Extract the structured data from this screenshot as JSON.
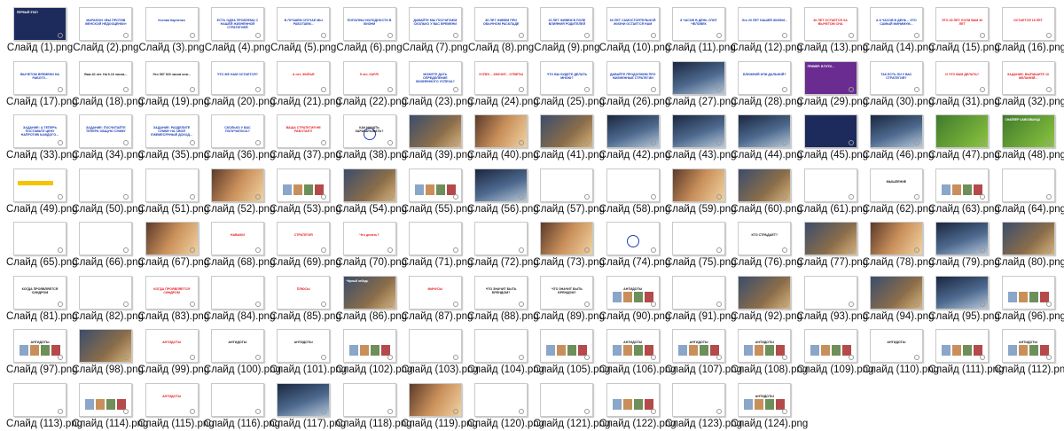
{
  "file_label_prefix": "Слайд",
  "file_label_suffix": ".png",
  "slides": [
    {
      "label": "Слайд (1).png",
      "kind": "navy",
      "text": "ПЕРВЫЙ ЭТАП"
    },
    {
      "label": "Слайд (2).png",
      "kind": "white-blue",
      "text": "МАРАФОН «ВЫ ПРОТИВ ЖЕНСКОЙ НЕДООЦЕНКИ»"
    },
    {
      "label": "Слайд (3).png",
      "kind": "white-blue",
      "text": "Ксения Карпенко"
    },
    {
      "label": "Слайд (4).png",
      "kind": "white-blue",
      "text": "ЕСТЬ ОДНА ПРОБЛЕМА С НАШЕЙ ЖИЗНЕННОЙ СТРАТЕГИЕЙ"
    },
    {
      "label": "Слайд (5).png",
      "kind": "white-blue",
      "text": "В ЛУЧШЕМ СЛУЧАЕ МЫ РАБОТАЕМ..."
    },
    {
      "label": "Слайд (6).png",
      "kind": "white-blue",
      "text": "ПОПОЛНЫ НОЛОДНОСТИ В ЖИЗНИ"
    },
    {
      "label": "Слайд (7).png",
      "kind": "white-blue",
      "text": "ДАВАЙТЕ МЫ ПОСЧИТАЕМ СКОЛЬКО У ВАС ВРЕМЕНИ"
    },
    {
      "label": "Слайд (8).png",
      "kind": "white-blue",
      "text": "80 ЛЕТ ЖИВЕМ ПРИ ОБЫЧНОМ РАСКЛАДЕ"
    },
    {
      "label": "Слайд (9).png",
      "kind": "white-blue",
      "text": "20 ЛЕТ ЖИВЕМ В ПОЛЕ ВЛИЯНИЯ РОДИТЕЛЕЙ"
    },
    {
      "label": "Слайд (10).png",
      "kind": "white-blue",
      "text": "60 ЛЕТ САМОСТОЯТЕЛЬНОЙ ЖИЗНИ ОСТАЕТСЯ НАМ"
    },
    {
      "label": "Слайд (11).png",
      "kind": "white-blue",
      "text": "8 ЧАСОВ В ДЕНЬ СПИТ ЧЕЛОВЕК"
    },
    {
      "label": "Слайд (12).png",
      "kind": "white-blue",
      "text": "Это 20 ЛЕТ НАШЕЙ ЖИЗНИ..."
    },
    {
      "label": "Слайд (13).png",
      "kind": "white-red",
      "text": "40 ЛЕТ ОСТАЕТСЯ ЗА ВЫЧЕТОМ СНА"
    },
    {
      "label": "Слайд (14).png",
      "kind": "white-blue",
      "text": "А 8 ЧАСОВ В ДЕНЬ – ЭТО САМЫЙ МИНИМУМ..."
    },
    {
      "label": "Слайд (15).png",
      "kind": "white-red",
      "text": "ЭТО 25 ЛЕТ. ЕСЛИ ВАМ 40 ЛЕТ"
    },
    {
      "label": "Слайд (16).png",
      "kind": "white-red",
      "text": "ОСТАЕТСЯ 15 ЛЕТ"
    },
    {
      "label": "Слайд (17).png",
      "kind": "white-blue",
      "text": "ВЫЧЕТОМ ВРЕМЕНИ НА РАБОТУ..."
    },
    {
      "label": "Слайд (18).png",
      "kind": "white-black",
      "text": "Вам 40 лет. На 9-10 часов..."
    },
    {
      "label": "Слайд (19).png",
      "kind": "white-black",
      "text": "Это 587 520 часов или..."
    },
    {
      "label": "Слайд (20).png",
      "kind": "white-blue",
      "text": "ЧТО ЖЕ НАМ ОСТАЕТСЯ?"
    },
    {
      "label": "Слайд (21).png",
      "kind": "white-red",
      "text": "А нет, ЖИЛЬЯ"
    },
    {
      "label": "Слайд (22).png",
      "kind": "white-red",
      "text": "5 лет, КАРЛ!"
    },
    {
      "label": "Слайд (23).png",
      "kind": "white-blue",
      "text": "МОЖЕТЕ ДАТЬ ОПРЕДЕЛЕНИЕ ЖИЗНЕННОГО УСПЕХА?"
    },
    {
      "label": "Слайд (24).png",
      "kind": "white-red",
      "text": "УСПЕХ – ЗНАЧИТ... ОТВЕТЫ"
    },
    {
      "label": "Слайд (25).png",
      "kind": "white-blue",
      "text": "ЧТО ВЫ БУДЕТЕ ДЕЛАТЬ МНОЮ?"
    },
    {
      "label": "Слайд (26).png",
      "kind": "white-blue",
      "text": "ДАВАЙТЕ ПРОДОЛЖИМ ПРО ЖИЗНЕННЫЕ СТРАТЕГИИ"
    },
    {
      "label": "Слайд (27).png",
      "kind": "photo2",
      "text": ""
    },
    {
      "label": "Слайд (28).png",
      "kind": "white-blue",
      "text": "БЛИЖНИЙ ИЛИ ДАЛЬНИЙ?"
    },
    {
      "label": "Слайд (29).png",
      "kind": "purple",
      "text": "ПРИМЕР: В ПУТИ..."
    },
    {
      "label": "Слайд (30).png",
      "kind": "white-blue",
      "text": "ТАК ЕСТЬ ЛИ У ВАС СТРАТЕГИЯ?"
    },
    {
      "label": "Слайд (31).png",
      "kind": "white-red",
      "text": "И ЧТО ВАМ ДЕЛАТЬ?"
    },
    {
      "label": "Слайд (32).png",
      "kind": "white-red",
      "text": "ЗАДАНИЕ: ВЫПИШИТЕ 10 ЖЕЛАНИЙ..."
    },
    {
      "label": "Слайд (33).png",
      "kind": "white-blue",
      "text": "ЗАДАНИЕ: А ТЕПЕРЬ ПОСТАВЬТЕ ЦЕНУ НАПРОТИВ КАЖДОГО..."
    },
    {
      "label": "Слайд (34).png",
      "kind": "white-blue",
      "text": "ЗАДАНИЕ: ПОСЧИТАЙТЕ ТЕПЕРЬ ОБЩУЮ СУММУ"
    },
    {
      "label": "Слайд (35).png",
      "kind": "white-blue",
      "text": "ЗАДАНИЕ: РАЗДЕЛИТЕ СУММУ НА СВОЙ ЕЖЕМЕСЯЧНЫЙ ДОХОД..."
    },
    {
      "label": "Слайд (36).png",
      "kind": "white-blue",
      "text": "СКОЛЬКО У ВАС ПОЛУЧИЛОСЬ?"
    },
    {
      "label": "Слайд (37).png",
      "kind": "white-red",
      "text": "ВАША СТРАТЕГИЯ НЕ РАБОТАЕТ!"
    },
    {
      "label": "Слайд (38).png",
      "kind": "white-diagram",
      "text": "КАК НАЧАТЬ ЗАРАБАТЫВАТЬ?"
    },
    {
      "label": "Слайд (39).png",
      "kind": "photo1",
      "text": ""
    },
    {
      "label": "Слайд (40).png",
      "kind": "photo3",
      "text": ""
    },
    {
      "label": "Слайд (41).png",
      "kind": "photo1",
      "text": ""
    },
    {
      "label": "Слайд (42).png",
      "kind": "photo2",
      "text": ""
    },
    {
      "label": "Слайд (43).png",
      "kind": "photo2",
      "text": ""
    },
    {
      "label": "Слайд (44).png",
      "kind": "photo2",
      "text": ""
    },
    {
      "label": "Слайд (45).png",
      "kind": "navy",
      "text": ""
    },
    {
      "label": "Слайд (46).png",
      "kind": "photo2",
      "text": ""
    },
    {
      "label": "Слайд (47).png",
      "kind": "green",
      "text": ""
    },
    {
      "label": "Слайд (48).png",
      "kind": "green",
      "text": "СНАЙПЕР САМОЗВАНЦА"
    },
    {
      "label": "Слайд (49).png",
      "kind": "white-yellow",
      "text": ""
    },
    {
      "label": "Слайд (50).png",
      "kind": "white-black",
      "text": ""
    },
    {
      "label": "Слайд (51).png",
      "kind": "white-black",
      "text": ""
    },
    {
      "label": "Слайд (52).png",
      "kind": "photo3",
      "text": ""
    },
    {
      "label": "Слайд (53).png",
      "kind": "white-collage",
      "text": ""
    },
    {
      "label": "Слайд (54).png",
      "kind": "photo1",
      "text": ""
    },
    {
      "label": "Слайд (55).png",
      "kind": "white-collage",
      "text": ""
    },
    {
      "label": "Слайд (56).png",
      "kind": "photo2",
      "text": ""
    },
    {
      "label": "Слайд (57).png",
      "kind": "white-black",
      "text": ""
    },
    {
      "label": "Слайд (58).png",
      "kind": "white-black",
      "text": ""
    },
    {
      "label": "Слайд (59).png",
      "kind": "photo3",
      "text": ""
    },
    {
      "label": "Слайд (60).png",
      "kind": "photo1",
      "text": ""
    },
    {
      "label": "Слайд (61).png",
      "kind": "white-black",
      "text": ""
    },
    {
      "label": "Слайд (62).png",
      "kind": "white-black",
      "text": "МЫШЛЕНИЕ"
    },
    {
      "label": "Слайд (63).png",
      "kind": "white-collage",
      "text": ""
    },
    {
      "label": "Слайд (64).png",
      "kind": "white-black",
      "text": ""
    },
    {
      "label": "Слайд (65).png",
      "kind": "white-black",
      "text": ""
    },
    {
      "label": "Слайд (66).png",
      "kind": "white-black",
      "text": ""
    },
    {
      "label": "Слайд (67).png",
      "kind": "photo3",
      "text": ""
    },
    {
      "label": "Слайд (68).png",
      "kind": "white-red",
      "text": "НАВЫКИ"
    },
    {
      "label": "Слайд (69).png",
      "kind": "white-red",
      "text": "СТРАТЕГИЯ"
    },
    {
      "label": "Слайд (70).png",
      "kind": "white-red",
      "text": "Что делать?"
    },
    {
      "label": "Слайд (71).png",
      "kind": "white-black",
      "text": ""
    },
    {
      "label": "Слайд (72).png",
      "kind": "white-black",
      "text": ""
    },
    {
      "label": "Слайд (73).png",
      "kind": "photo3",
      "text": ""
    },
    {
      "label": "Слайд (74).png",
      "kind": "white-diagram",
      "text": ""
    },
    {
      "label": "Слайд (75).png",
      "kind": "white-red",
      "text": ""
    },
    {
      "label": "Слайд (76).png",
      "kind": "white-black",
      "text": "КТО СТРАДАЕТ?"
    },
    {
      "label": "Слайд (77).png",
      "kind": "photo1",
      "text": ""
    },
    {
      "label": "Слайд (78).png",
      "kind": "photo3",
      "text": ""
    },
    {
      "label": "Слайд (79).png",
      "kind": "photo2",
      "text": ""
    },
    {
      "label": "Слайд (80).png",
      "kind": "photo1",
      "text": ""
    },
    {
      "label": "Слайд (81).png",
      "kind": "white-black",
      "text": "КОГДА ПРОЯВЛЯЕТСЯ СИНДРОМ"
    },
    {
      "label": "Слайд (82).png",
      "kind": "white-black",
      "text": ""
    },
    {
      "label": "Слайд (83).png",
      "kind": "white-red",
      "text": "КОГДА ПРОЯВЛЯЕТСЯ СИНДРОМ"
    },
    {
      "label": "Слайд (84).png",
      "kind": "white-red",
      "text": ""
    },
    {
      "label": "Слайд (85).png",
      "kind": "white-red",
      "text": "ПЛЮСЫ"
    },
    {
      "label": "Слайд (86).png",
      "kind": "photo1",
      "text": "Чёрный лебедь"
    },
    {
      "label": "Слайд (87).png",
      "kind": "white-red",
      "text": "МИНУСЫ"
    },
    {
      "label": "Слайд (88).png",
      "kind": "white-black",
      "text": "ЧТО ЗНАЧИТ БЫТЬ БРЕНДОМ?"
    },
    {
      "label": "Слайд (89).png",
      "kind": "white-black",
      "text": "ЧТО ЗНАЧИТ БЫТЬ БРЕНДОМ?"
    },
    {
      "label": "Слайд (90).png",
      "kind": "white-collage",
      "text": "АНТИДОТЫ"
    },
    {
      "label": "Слайд (91).png",
      "kind": "white-black",
      "text": ""
    },
    {
      "label": "Слайд (92).png",
      "kind": "photo1",
      "text": ""
    },
    {
      "label": "Слайд (93).png",
      "kind": "white-red",
      "text": ""
    },
    {
      "label": "Слайд (94).png",
      "kind": "photo1",
      "text": ""
    },
    {
      "label": "Слайд (95).png",
      "kind": "photo2",
      "text": ""
    },
    {
      "label": "Слайд (96).png",
      "kind": "white-collage",
      "text": ""
    },
    {
      "label": "Слайд (97).png",
      "kind": "white-collage",
      "text": "АНТИДОТЫ"
    },
    {
      "label": "Слайд (98).png",
      "kind": "photo1",
      "text": ""
    },
    {
      "label": "Слайд (99).png",
      "kind": "white-red",
      "text": "АНТИДОТЫ"
    },
    {
      "label": "Слайд (100).png",
      "kind": "white-black",
      "text": "АНТИДОТЫ"
    },
    {
      "label": "Слайд (101).png",
      "kind": "white-black",
      "text": "АНТИДОТЫ"
    },
    {
      "label": "Слайд (102).png",
      "kind": "white-collage",
      "text": ""
    },
    {
      "label": "Слайд (103).png",
      "kind": "white-black",
      "text": ""
    },
    {
      "label": "Слайд (104).png",
      "kind": "white-red",
      "text": ""
    },
    {
      "label": "Слайд (105).png",
      "kind": "white-collage",
      "text": ""
    },
    {
      "label": "Слайд (106).png",
      "kind": "white-collage",
      "text": "АНТИДОТЫ"
    },
    {
      "label": "Слайд (107).png",
      "kind": "white-collage",
      "text": "АНТИДОТЫ"
    },
    {
      "label": "Слайд (108).png",
      "kind": "white-collage",
      "text": "АНТИДОТЫ"
    },
    {
      "label": "Слайд (109).png",
      "kind": "white-collage",
      "text": ""
    },
    {
      "label": "Слайд (110).png",
      "kind": "white-black",
      "text": "АНТИДОТЫ"
    },
    {
      "label": "Слайд (111).png",
      "kind": "white-collage",
      "text": ""
    },
    {
      "label": "Слайд (112).png",
      "kind": "white-collage",
      "text": "АНТИДОТЫ"
    },
    {
      "label": "Слайд (113).png",
      "kind": "white-black",
      "text": ""
    },
    {
      "label": "Слайд (114).png",
      "kind": "white-collage",
      "text": ""
    },
    {
      "label": "Слайд (115).png",
      "kind": "white-red",
      "text": "АНТИДОТЫ"
    },
    {
      "label": "Слайд (116).png",
      "kind": "white-red",
      "text": ""
    },
    {
      "label": "Слайд (117).png",
      "kind": "photo2",
      "text": ""
    },
    {
      "label": "Слайд (118).png",
      "kind": "white-black",
      "text": ""
    },
    {
      "label": "Слайд (119).png",
      "kind": "photo3",
      "text": ""
    },
    {
      "label": "Слайд (120).png",
      "kind": "white-black",
      "text": ""
    },
    {
      "label": "Слайд (121).png",
      "kind": "white-red",
      "text": ""
    },
    {
      "label": "Слайд (122).png",
      "kind": "white-collage",
      "text": ""
    },
    {
      "label": "Слайд (123).png",
      "kind": "white-red",
      "text": ""
    },
    {
      "label": "Слайд (124).png",
      "kind": "white-collage",
      "text": "АНТИДОТЫ"
    }
  ]
}
